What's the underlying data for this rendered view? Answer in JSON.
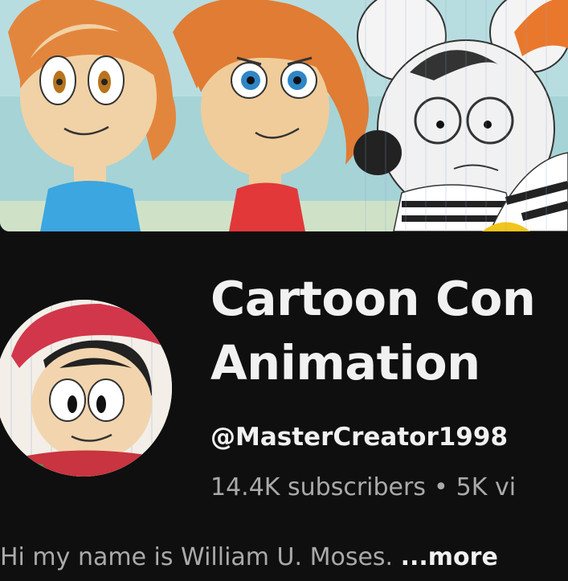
{
  "channel": {
    "title": "Cartoon Con\nAnimation",
    "handle": "@MasterCreator1998",
    "subscribers": "14.4K subscribers",
    "separator": "•",
    "videos": "5K vi",
    "description": "Hi my name is William U. Moses. ",
    "more_label": "...more"
  },
  "colors": {
    "background": "#0f0f0f",
    "primary_text": "#f1f1f1",
    "secondary_text": "#aaaaaa"
  }
}
